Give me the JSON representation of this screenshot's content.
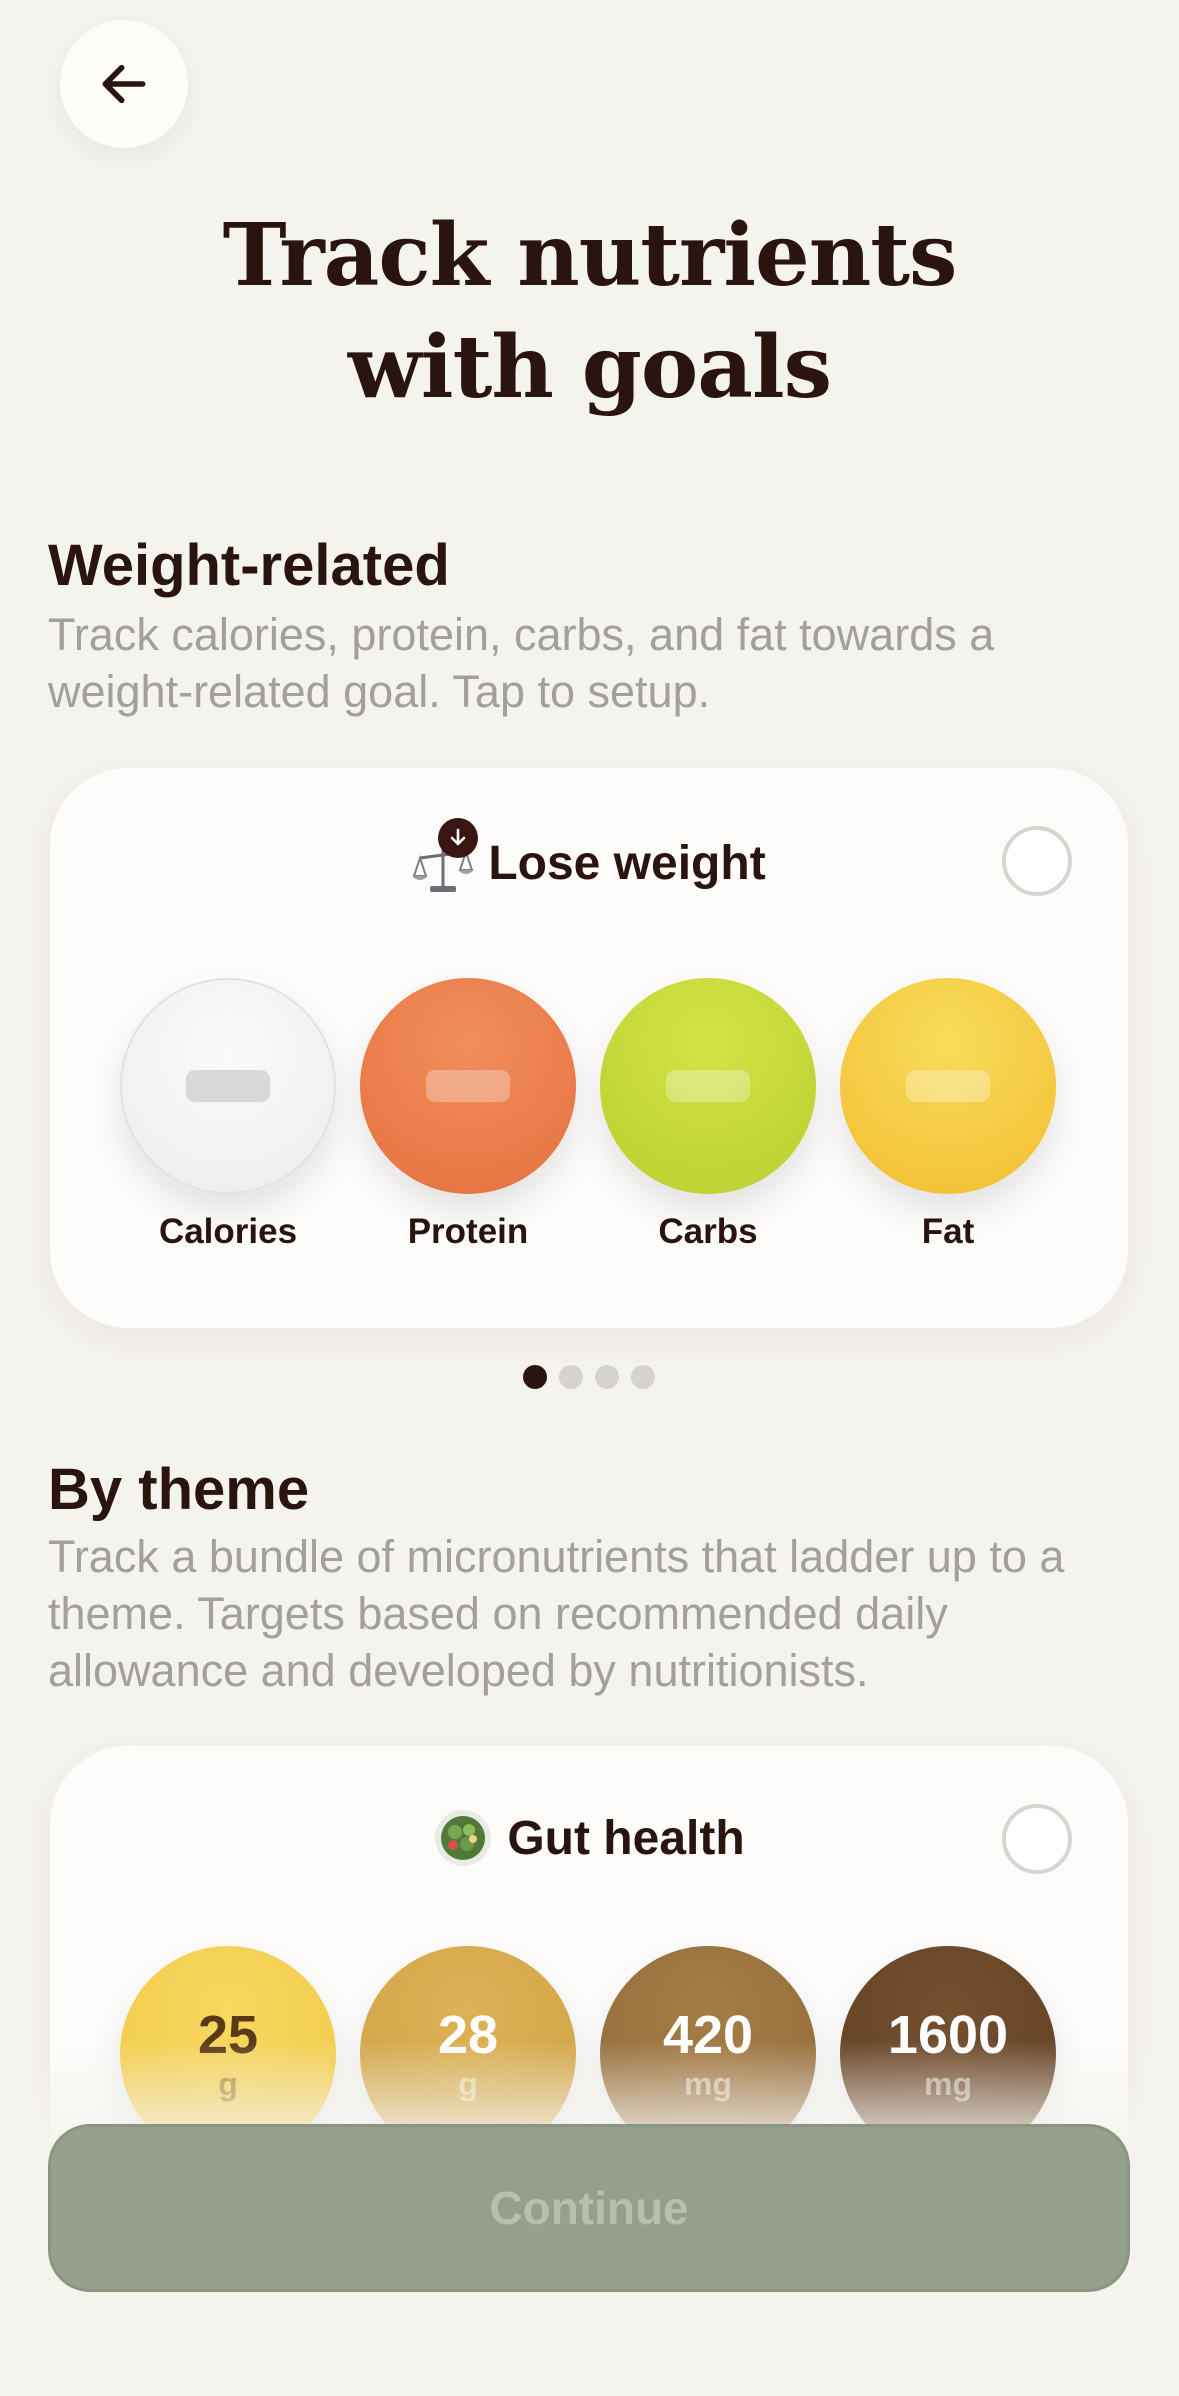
{
  "header": {
    "back_icon": "arrow-left-icon",
    "title_line1": "Track nutrients",
    "title_line2": "with goals"
  },
  "weight_section": {
    "heading": "Weight-related",
    "description": "Track calories, protein, carbs, and fat towards a weight-related goal. Tap to setup.",
    "card": {
      "icon": "scale-down-icon",
      "title": "Lose weight",
      "selected": false,
      "nutrients": [
        {
          "label": "Calories",
          "color": "#f6f4f2"
        },
        {
          "label": "Protein",
          "color": "#ea7a4c"
        },
        {
          "label": "Carbs",
          "color": "#c7da3d"
        },
        {
          "label": "Fat",
          "color": "#f5c53c"
        }
      ]
    },
    "pager": {
      "pages": 4,
      "active": 1
    }
  },
  "theme_section": {
    "heading": "By theme",
    "description": "Track a bundle of micronutrients that ladder up to a theme. Targets based on recommended daily allowance and developed by nutritionists.",
    "card": {
      "icon": "salad-bowl-icon",
      "title": "Gut health",
      "selected": false,
      "values": [
        {
          "value": "25",
          "unit": "g",
          "color": "#f4cf55"
        },
        {
          "value": "28",
          "unit": "g",
          "color": "#d4a849"
        },
        {
          "value": "420",
          "unit": "mg",
          "color": "#9a733d"
        },
        {
          "value": "1600",
          "unit": "mg",
          "color": "#6a4628"
        }
      ]
    }
  },
  "footer": {
    "continue_label": "Continue",
    "continue_enabled": false
  }
}
